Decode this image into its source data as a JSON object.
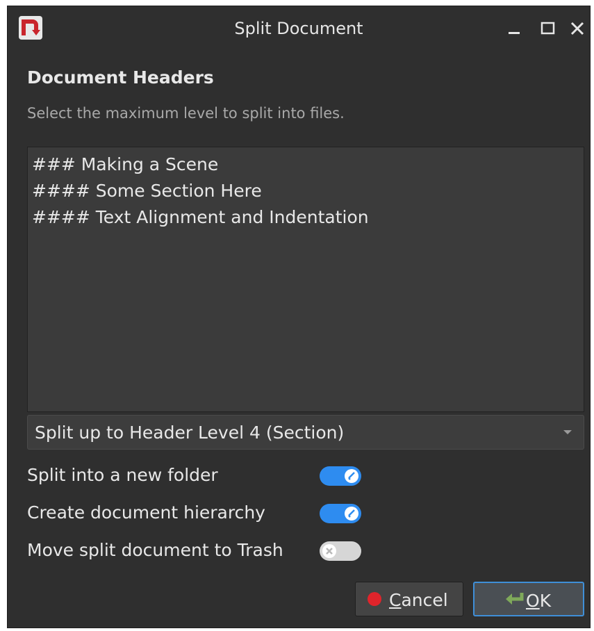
{
  "window": {
    "title": "Split Document",
    "controls": {
      "minimize": "minimize-icon",
      "maximize": "maximize-icon",
      "close": "close-icon"
    }
  },
  "section": {
    "heading": "Document Headers",
    "description": "Select the maximum level to split into files."
  },
  "headers_list": [
    "### Making a Scene",
    "#### Some Section Here",
    "#### Text Alignment and Indentation"
  ],
  "split_level": {
    "selected": "Split up to Header Level 4 (Section)"
  },
  "options": [
    {
      "label": "Split into a new folder",
      "enabled": true
    },
    {
      "label": "Create document hierarchy",
      "enabled": true
    },
    {
      "label": "Move split document to Trash",
      "enabled": false
    }
  ],
  "buttons": {
    "cancel": "Cancel",
    "ok": "OK"
  },
  "colors": {
    "accent": "#2e8cf0",
    "cancel_icon": "#e0242b",
    "ok_icon": "#7fa95a",
    "app_icon": "#c9252c"
  }
}
